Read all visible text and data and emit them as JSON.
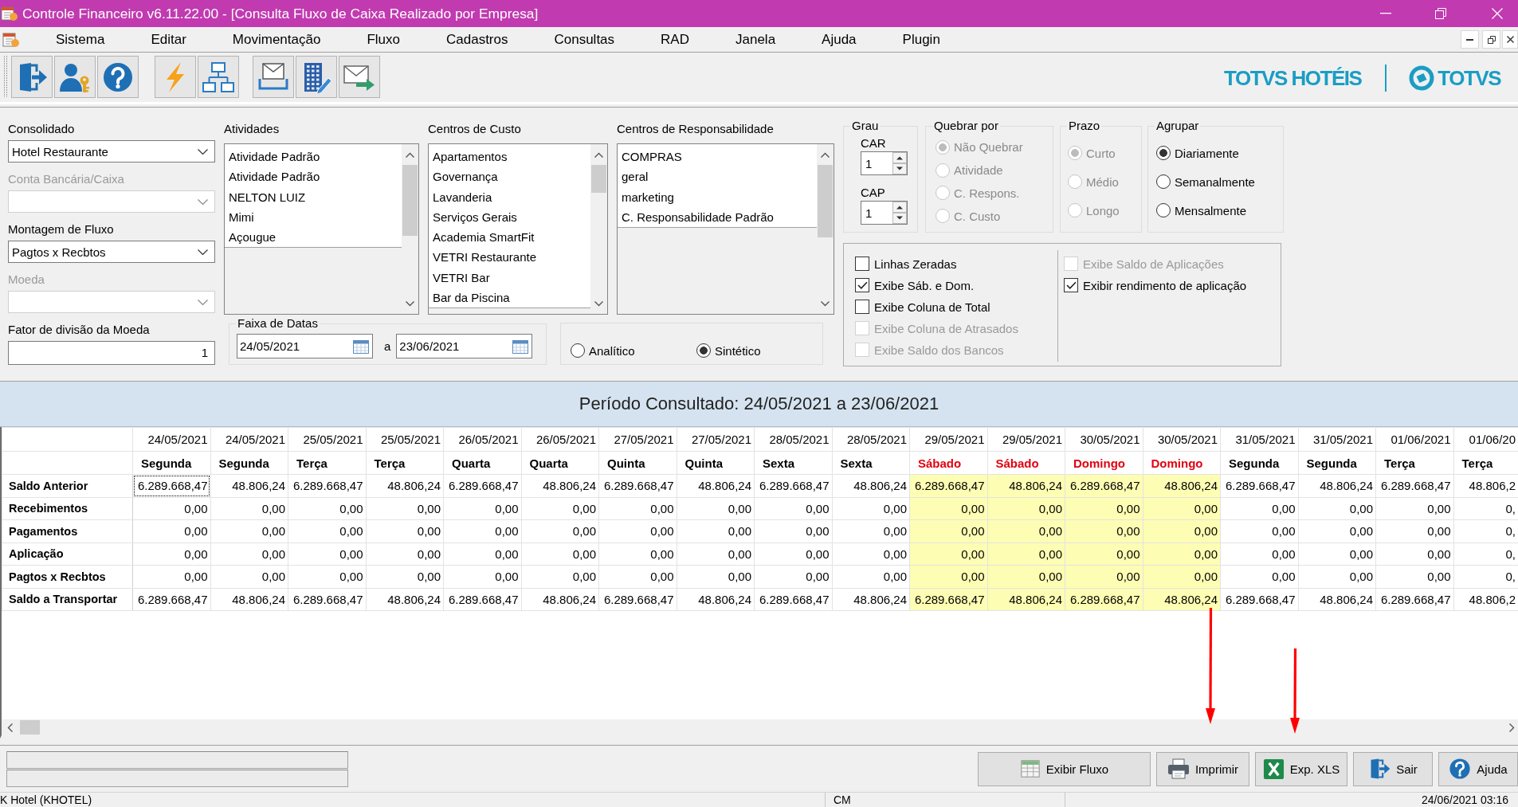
{
  "window": {
    "title": "Controle Financeiro v6.11.22.00 - [Consulta Fluxo de Caixa Realizado por Empresa]"
  },
  "menu": [
    "Sistema",
    "Editar",
    "Movimentação",
    "Fluxo",
    "Cadastros",
    "Consultas",
    "RAD",
    "Janela",
    "Ajuda",
    "Plugin"
  ],
  "brand": {
    "product": "TOTVS HOTÉIS",
    "company": "TOTVS"
  },
  "filters": {
    "fields": [
      {
        "kind": "combo",
        "label": "Consolidado",
        "value": "Hotel Restaurante",
        "disabled": false
      },
      {
        "kind": "combo",
        "label": "Conta Bancária/Caixa",
        "disabled": true
      },
      {
        "kind": "combo",
        "label": "Montagem de Fluxo",
        "value": "Pagtos x Recbtos",
        "disabled": false
      },
      {
        "kind": "combo",
        "label": "Moeda",
        "disabled": true
      },
      {
        "kind": "number",
        "label": "Fator de divisão da Moeda",
        "value": "1",
        "disabled": false
      }
    ],
    "lists": [
      {
        "title": "Atividades",
        "items": [
          {
            "label": "Atividade Padrão",
            "selected": false
          },
          {
            "label": "Atividade Padrão",
            "selected": false
          },
          {
            "label": "NELTON LUIZ",
            "selected": false
          },
          {
            "label": "Mimi",
            "selected": false
          },
          {
            "label": "Açougue",
            "selected": false
          }
        ]
      },
      {
        "title": "Centros de Custo",
        "items": [
          {
            "label": "Apartamentos",
            "selected": false
          },
          {
            "label": "Governança",
            "selected": false
          },
          {
            "label": "Lavanderia",
            "selected": false
          },
          {
            "label": "Serviços Gerais",
            "selected": false
          },
          {
            "label": "Academia SmartFit",
            "selected": false
          },
          {
            "label": "VETRI Restaurante",
            "selected": false
          },
          {
            "label": "VETRI Bar",
            "selected": false
          },
          {
            "label": "Bar da Piscina",
            "selected": false
          }
        ]
      },
      {
        "title": "Centros de Responsabilidade",
        "items": [
          {
            "label": "COMPRAS",
            "selected": false
          },
          {
            "label": "geral",
            "selected": false
          },
          {
            "label": "marketing",
            "selected": false
          },
          {
            "label": "C. Responsabilidade Padrão",
            "selected": false
          }
        ]
      }
    ],
    "date_range": {
      "title": "Faixa de Datas",
      "from": "24/05/2021",
      "separator": "a",
      "to": "23/06/2021"
    },
    "mode": [
      {
        "label": "Analítico",
        "selected": false
      },
      {
        "label": "Sintético",
        "selected": true
      }
    ],
    "grau": {
      "title": "Grau",
      "spinners": [
        {
          "label": "CAR",
          "value": "1"
        },
        {
          "label": "CAP",
          "value": "1"
        }
      ]
    },
    "radio_groups": [
      {
        "title": "Quebrar por",
        "options": [
          {
            "label": "Não Quebrar",
            "selected": true,
            "disabled": true
          },
          {
            "label": "Atividade",
            "selected": false,
            "disabled": true
          },
          {
            "label": "C. Respons.",
            "selected": false,
            "disabled": true
          },
          {
            "label": "C. Custo",
            "selected": false,
            "disabled": true
          }
        ]
      },
      {
        "title": "Prazo",
        "options": [
          {
            "label": "Curto",
            "selected": true,
            "disabled": true
          },
          {
            "label": "Médio",
            "selected": false,
            "disabled": true
          },
          {
            "label": "Longo",
            "selected": false,
            "disabled": true
          }
        ]
      },
      {
        "title": "Agrupar",
        "options": [
          {
            "label": "Diariamente",
            "selected": true,
            "disabled": false
          },
          {
            "label": "Semanalmente",
            "selected": false,
            "disabled": false
          },
          {
            "label": "Mensalmente",
            "selected": false,
            "disabled": false
          }
        ]
      }
    ],
    "checkboxes": [
      [
        {
          "label": "Linhas Zeradas",
          "checked": false,
          "disabled": false
        },
        {
          "label": "Exibe Sáb. e Dom.",
          "checked": true,
          "disabled": false
        },
        {
          "label": "Exibe Coluna de Total",
          "checked": false,
          "disabled": false
        },
        {
          "label": "Exibe Coluna de Atrasados",
          "checked": false,
          "disabled": true
        },
        {
          "label": "Exibe Saldo dos Bancos",
          "checked": false,
          "disabled": true
        }
      ],
      [
        {
          "label": "Exibe Saldo de Aplicações",
          "checked": false,
          "disabled": true
        },
        {
          "label": "Exibir rendimento de aplicação",
          "checked": true,
          "disabled": false
        }
      ]
    ]
  },
  "period": "Período Consultado: 24/05/2021 a 23/06/2021",
  "table": {
    "focus_first_cell": true,
    "columns": [
      {
        "date": "24/05/2021",
        "weekday": "Segunda",
        "weekend": false
      },
      {
        "date": "24/05/2021",
        "weekday": "Segunda",
        "weekend": false
      },
      {
        "date": "25/05/2021",
        "weekday": "Terça",
        "weekend": false
      },
      {
        "date": "25/05/2021",
        "weekday": "Terça",
        "weekend": false
      },
      {
        "date": "26/05/2021",
        "weekday": "Quarta",
        "weekend": false
      },
      {
        "date": "26/05/2021",
        "weekday": "Quarta",
        "weekend": false
      },
      {
        "date": "27/05/2021",
        "weekday": "Quinta",
        "weekend": false
      },
      {
        "date": "27/05/2021",
        "weekday": "Quinta",
        "weekend": false
      },
      {
        "date": "28/05/2021",
        "weekday": "Sexta",
        "weekend": false
      },
      {
        "date": "28/05/2021",
        "weekday": "Sexta",
        "weekend": false
      },
      {
        "date": "29/05/2021",
        "weekday": "Sábado",
        "weekend": true
      },
      {
        "date": "29/05/2021",
        "weekday": "Sábado",
        "weekend": true
      },
      {
        "date": "30/05/2021",
        "weekday": "Domingo",
        "weekend": true
      },
      {
        "date": "30/05/2021",
        "weekday": "Domingo",
        "weekend": true
      },
      {
        "date": "31/05/2021",
        "weekday": "Segunda",
        "weekend": false
      },
      {
        "date": "31/05/2021",
        "weekday": "Segunda",
        "weekend": false
      },
      {
        "date": "01/06/2021",
        "weekday": "Terça",
        "weekend": false
      },
      {
        "date": "01/06/20",
        "weekday": "Terça",
        "weekend": false
      }
    ],
    "rows": [
      {
        "label": "Saldo Anterior",
        "values": [
          "6.289.668,47",
          "48.806,24",
          "6.289.668,47",
          "48.806,24",
          "6.289.668,47",
          "48.806,24",
          "6.289.668,47",
          "48.806,24",
          "6.289.668,47",
          "48.806,24",
          "6.289.668,47",
          "48.806,24",
          "6.289.668,47",
          "48.806,24",
          "6.289.668,47",
          "48.806,24",
          "6.289.668,47",
          "48.806,2"
        ]
      },
      {
        "label": "Recebimentos",
        "values": [
          "0,00",
          "0,00",
          "0,00",
          "0,00",
          "0,00",
          "0,00",
          "0,00",
          "0,00",
          "0,00",
          "0,00",
          "0,00",
          "0,00",
          "0,00",
          "0,00",
          "0,00",
          "0,00",
          "0,00",
          "0,"
        ]
      },
      {
        "label": "Pagamentos",
        "values": [
          "0,00",
          "0,00",
          "0,00",
          "0,00",
          "0,00",
          "0,00",
          "0,00",
          "0,00",
          "0,00",
          "0,00",
          "0,00",
          "0,00",
          "0,00",
          "0,00",
          "0,00",
          "0,00",
          "0,00",
          "0,"
        ]
      },
      {
        "label": "Aplicação",
        "values": [
          "0,00",
          "0,00",
          "0,00",
          "0,00",
          "0,00",
          "0,00",
          "0,00",
          "0,00",
          "0,00",
          "0,00",
          "0,00",
          "0,00",
          "0,00",
          "0,00",
          "0,00",
          "0,00",
          "0,00",
          "0,"
        ]
      },
      {
        "label": "Pagtos x Recbtos",
        "values": [
          "0,00",
          "0,00",
          "0,00",
          "0,00",
          "0,00",
          "0,00",
          "0,00",
          "0,00",
          "0,00",
          "0,00",
          "0,00",
          "0,00",
          "0,00",
          "0,00",
          "0,00",
          "0,00",
          "0,00",
          "0,"
        ]
      },
      {
        "label": "Saldo a Transportar",
        "values": [
          "6.289.668,47",
          "48.806,24",
          "6.289.668,47",
          "48.806,24",
          "6.289.668,47",
          "48.806,24",
          "6.289.668,47",
          "48.806,24",
          "6.289.668,47",
          "48.806,24",
          "6.289.668,47",
          "48.806,24",
          "6.289.668,47",
          "48.806,24",
          "6.289.668,47",
          "48.806,24",
          "6.289.668,47",
          "48.806,2"
        ]
      }
    ]
  },
  "buttons": [
    {
      "kind": "view",
      "label": "Exibir Fluxo"
    },
    {
      "kind": "print",
      "label": "Imprimir"
    },
    {
      "kind": "excel",
      "label": "Exp. XLS"
    },
    {
      "kind": "exit",
      "label": "Sair"
    },
    {
      "kind": "help",
      "label": "Ajuda"
    }
  ],
  "status_bar": [
    "K Hotel (KHOTEL)",
    "CM",
    "24/06/2021 03:16"
  ]
}
